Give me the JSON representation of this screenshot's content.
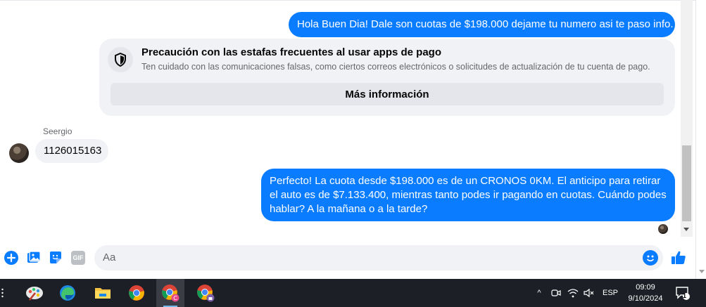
{
  "messages": {
    "outgoing_1": "Hola Buen Dia! Dale son cuotas de $198.000 dejame tu numero asi te paso info.",
    "warning": {
      "title": "Precaución con las estafas frecuentes al usar apps de pago",
      "description": "Ten cuidado con las comunicaciones falsas, como ciertos correos electrónicos o solicitudes de actualización de tu cuenta de pago.",
      "button": "Más información",
      "icon": "shield-icon"
    },
    "incoming_sender": "Seergio",
    "incoming_1": "1126015163",
    "outgoing_2": "Perfecto! La cuota desde $198.000 es de un CRONOS 0KM. El anticipo para retirar el auto es de $7.133.400, mientras tanto podes ir pagando en cuotas. Cuándo podes hablar? A la mañana o a la tarde?"
  },
  "composer": {
    "placeholder": "Aa",
    "icons": [
      "plus-icon",
      "image-icon",
      "sticker-icon",
      "gif-icon",
      "emoji-icon",
      "like-icon"
    ],
    "gif_label": "GIF"
  },
  "taskbar": {
    "apps": [
      "paint-icon",
      "edge-icon",
      "file-explorer-icon",
      "chrome-icon",
      "chrome-profile-icon",
      "chrome-profile-2-icon"
    ],
    "tray": {
      "chevron": "^",
      "language": "ESP",
      "time": "09:09",
      "date": "9/10/2024",
      "notifications": "1"
    }
  },
  "colors": {
    "accent": "#0a7cff",
    "bubble_in": "#f0f2f5",
    "taskbar": "#1c1f26"
  }
}
